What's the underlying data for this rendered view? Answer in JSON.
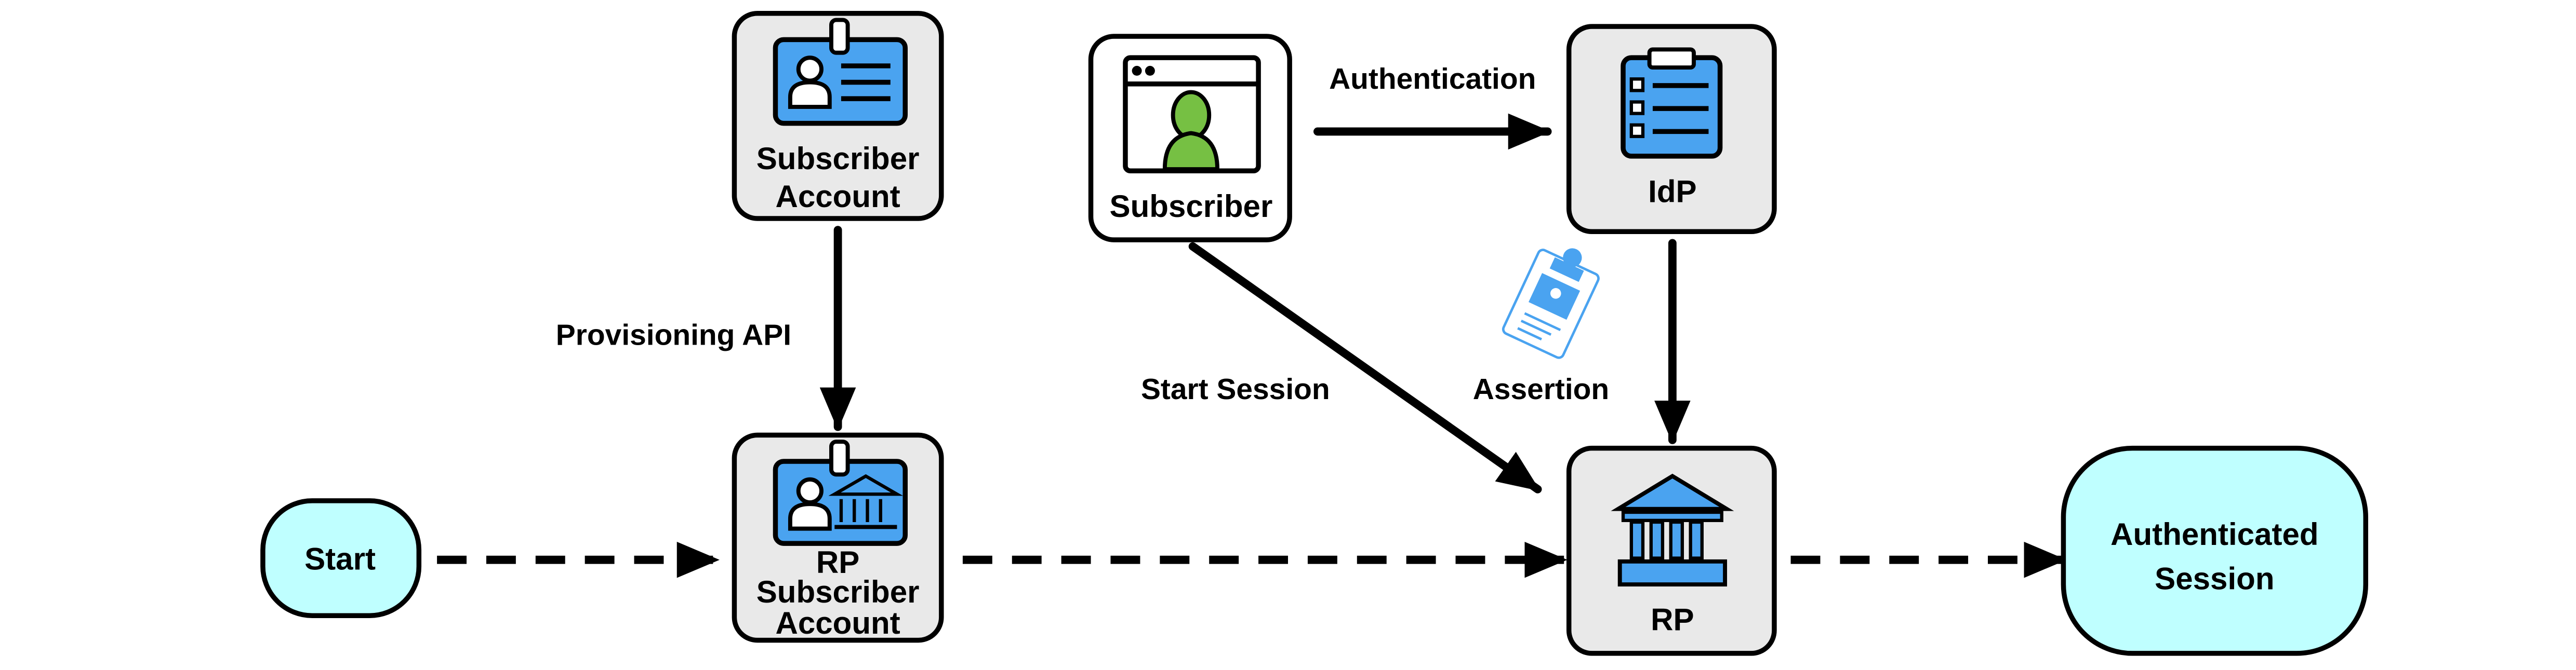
{
  "nodes": {
    "subscriber_account": {
      "line1": "Subscriber",
      "line2": "Account",
      "icon": "id-badge-icon"
    },
    "subscriber": {
      "label": "Subscriber",
      "icon": "browser-user-icon"
    },
    "idp": {
      "label": "IdP",
      "icon": "clipboard-checklist-icon"
    },
    "rp_subscriber_account": {
      "line1": "RP",
      "line2": "Subscriber",
      "line3": "Account",
      "icon": "id-badge-bank-icon"
    },
    "rp": {
      "label": "RP",
      "icon": "bank-icon"
    },
    "start": {
      "label": "Start"
    },
    "authenticated_session": {
      "line1": "Authenticated",
      "line2": "Session"
    }
  },
  "edges": {
    "provisioning": "Provisioning API",
    "authentication": "Authentication",
    "start_session": "Start Session",
    "assertion": "Assertion"
  },
  "colors": {
    "box_fill": "#e9e9e9",
    "terminal_fill": "#bfffff",
    "icon_blue": "#4aa3f0",
    "user_green": "#76c043"
  }
}
